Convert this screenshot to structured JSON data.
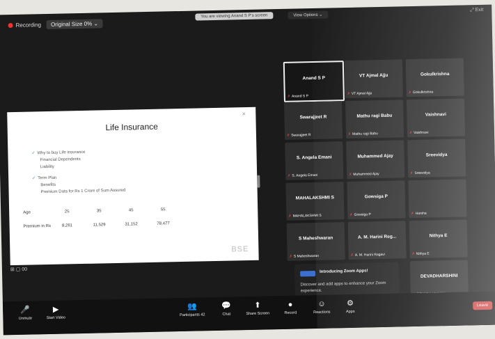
{
  "topbar": {
    "recording_label": "Recording",
    "view_label": "Original Size 0% ⌄",
    "center_notice": "You are viewing Anand S P's screen",
    "view_options": "View Options ⌄",
    "exit_fullscreen": "⤢ Exit"
  },
  "slide": {
    "title": "Life Insurance",
    "bullets": [
      {
        "text": "Why to buy Life insurance",
        "level": 1
      },
      {
        "text": "Financial Dependents",
        "level": 2
      },
      {
        "text": "Liability",
        "level": 2
      },
      {
        "text": "Term Plan",
        "level": 1
      },
      {
        "text": "Benefits",
        "level": 2
      },
      {
        "text": "Premium Data for Rs 1 Crore of Sum Assured",
        "level": 2
      }
    ],
    "table": {
      "header": [
        "Age",
        "25",
        "35",
        "45",
        "55"
      ],
      "row": [
        "Premium in Rs",
        "8,261",
        "11,529",
        "31,152",
        "78,477"
      ]
    },
    "logo": "BSE",
    "close_label": "✕"
  },
  "share_status": "⊞ ▢ 00",
  "participants": [
    {
      "name": "Anand S P",
      "label": "Anand S P",
      "active": true
    },
    {
      "name": "VT Ajmal Ajju",
      "label": "VT Ajmal Ajju",
      "active": false
    },
    {
      "name": "Gokulkrishna",
      "label": "Gokulkrishna",
      "active": false
    },
    {
      "name": "Swarajjeet R",
      "label": "Swarajjeet R",
      "active": false
    },
    {
      "name": "Mathu ragi Babu",
      "label": "Mathu ragi Babu",
      "active": false
    },
    {
      "name": "Vaishnavi",
      "label": "Vaishnavi",
      "active": false
    },
    {
      "name": "S. Angela Emani",
      "label": "S. Angela Emani",
      "active": false
    },
    {
      "name": "Muhammed Ajay",
      "label": "Muhammed Ajay",
      "active": false
    },
    {
      "name": "Sreevidya",
      "label": "Sreevidya",
      "active": false
    },
    {
      "name": "MAHALAKSHMI S",
      "label": "MAHALAKSHMI S",
      "active": false
    },
    {
      "name": "Gowsiga P",
      "label": "Gowsiga P",
      "active": false
    },
    {
      "name": "",
      "label": "Harsha",
      "active": false
    },
    {
      "name": "S Maheshwaran",
      "label": "S Maheshwaran",
      "active": false
    },
    {
      "name": "A. M. Harini Reg...",
      "label": "A. M. Harini Ragavi",
      "active": false
    },
    {
      "name": "Nithya E",
      "label": "Nithya E",
      "active": false
    },
    {
      "name": "DEVADHARSHINI",
      "label": "DEVADHARSHINI",
      "active": false
    }
  ],
  "apps_popup": {
    "title": "Introducing Zoom Apps!",
    "description": "Discover and add apps to enhance your Zoom experience."
  },
  "toolbar": {
    "buttons": [
      {
        "id": "unmute",
        "label": "Unmute",
        "icon": "🎤"
      },
      {
        "id": "video",
        "label": "Start Video",
        "icon": "▶"
      },
      {
        "id": "participants",
        "label": "Participants",
        "icon": "👥",
        "count": "42"
      },
      {
        "id": "chat",
        "label": "Chat",
        "icon": "💬"
      },
      {
        "id": "share",
        "label": "Share Screen",
        "icon": "⬆"
      },
      {
        "id": "record",
        "label": "Record",
        "icon": "●"
      },
      {
        "id": "reactions",
        "label": "Reactions",
        "icon": "☺"
      },
      {
        "id": "apps",
        "label": "Apps",
        "icon": "⚙"
      }
    ],
    "end_label": "Leave"
  },
  "colors": {
    "accent": "#3b6fd1",
    "record": "#e33333",
    "leave": "#d63c3c"
  }
}
